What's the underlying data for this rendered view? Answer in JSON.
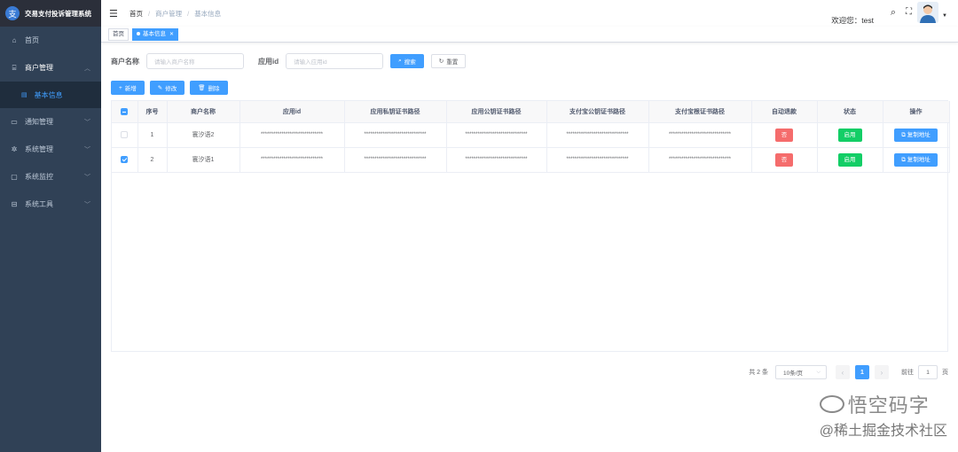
{
  "app": {
    "title": "交易支付投诉管理系统",
    "logo_glyph": "支"
  },
  "sidebar": {
    "items": [
      {
        "label": "首页",
        "icon": "dashboard-icon",
        "glyph": "⌂"
      },
      {
        "label": "商户管理",
        "icon": "merchant-icon",
        "glyph": "⌸",
        "open": true
      },
      {
        "label": "基本信息",
        "icon": "document-icon",
        "glyph": "▤",
        "sub": true
      },
      {
        "label": "通知管理",
        "icon": "message-icon",
        "glyph": "▭"
      },
      {
        "label": "系统管理",
        "icon": "gear-icon",
        "glyph": "✲"
      },
      {
        "label": "系统监控",
        "icon": "monitor-icon",
        "glyph": "▢"
      },
      {
        "label": "系统工具",
        "icon": "toolbox-icon",
        "glyph": "⊟"
      }
    ]
  },
  "navbar": {
    "breadcrumb": [
      "首页",
      "商户管理",
      "基本信息"
    ],
    "welcome": "欢迎您：test"
  },
  "tags": {
    "home": "首页",
    "active": "基本信息"
  },
  "search": {
    "merchant_label": "商户名称",
    "merchant_placeholder": "请输入商户名称",
    "appid_label": "应用id",
    "appid_placeholder": "请输入应用id",
    "search_btn": "搜索",
    "reset_btn": "重置"
  },
  "toolbar": {
    "add": "新增",
    "edit": "修改",
    "delete": "删除"
  },
  "table": {
    "headers": [
      "序号",
      "商户名称",
      "应用id",
      "应用私钥证书路径",
      "应用公钥证书路径",
      "支付宝公钥证书路径",
      "支付宝根证书路径",
      "自动退款",
      "状态",
      "操作"
    ],
    "rows": [
      {
        "checked": false,
        "index": "1",
        "name": "寰汐语2",
        "appid": "******************************",
        "priv": "******************************",
        "pub": "******************************",
        "alipub": "******************************",
        "aliroot": "******************************",
        "refund": "否",
        "status": "启用",
        "action": "复制地址"
      },
      {
        "checked": true,
        "index": "2",
        "name": "寰汐语1",
        "appid": "******************************",
        "priv": "******************************",
        "pub": "******************************",
        "alipub": "******************************",
        "aliroot": "******************************",
        "refund": "否",
        "status": "启用",
        "action": "复制地址"
      }
    ]
  },
  "pagination": {
    "total": "共 2 条",
    "page_size": "10条/页",
    "current": "1",
    "goto_label": "前往",
    "goto_value": "1",
    "page_unit": "页"
  },
  "watermark": {
    "line1": "悟空码字",
    "line2": "@稀土掘金技术社区"
  },
  "colors": {
    "sidebar": "#304156",
    "primary": "#409eff",
    "danger": "#f56c6c",
    "success": "#13ce66"
  }
}
